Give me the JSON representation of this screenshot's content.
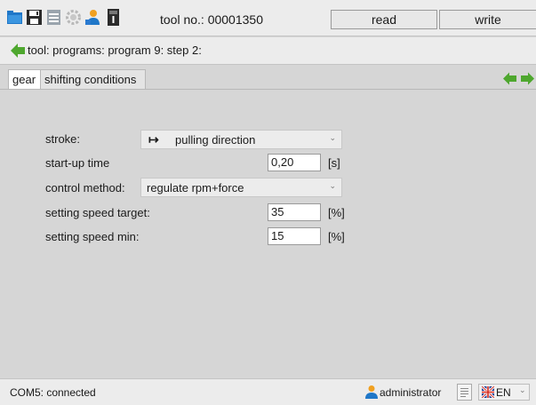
{
  "toolbar": {
    "icons": [
      "folder-open-icon",
      "save-icon",
      "print-icon",
      "settings-gear-icon",
      "user-transfer-icon",
      "device-info-icon"
    ],
    "tool_no_label": "tool no.: 00001350",
    "read_label": "read",
    "write_label": "write"
  },
  "breadcrumb": {
    "text": "tool: programs: program 9: step 2:"
  },
  "tabs": [
    {
      "label": "gear",
      "active": true
    },
    {
      "label": "shifting conditions",
      "active": false
    }
  ],
  "form": {
    "stroke_label": "stroke:",
    "stroke_value": "pulling direction",
    "startup_label": "start-up time",
    "startup_value": "0,20",
    "startup_unit": "[s]",
    "control_label": "control method:",
    "control_value": "regulate rpm+force",
    "speed_target_label": "setting speed  target:",
    "speed_target_value": "35",
    "speed_target_unit": "[%]",
    "speed_min_label": "setting speed  min:",
    "speed_min_value": "15",
    "speed_min_unit": "[%]"
  },
  "status": {
    "connection": "COM5: connected",
    "user": "administrator",
    "language": "EN"
  },
  "colors": {
    "arrow_green": "#4ea72e",
    "folder_blue": "#1f77c8",
    "user_orange": "#f0a020"
  }
}
